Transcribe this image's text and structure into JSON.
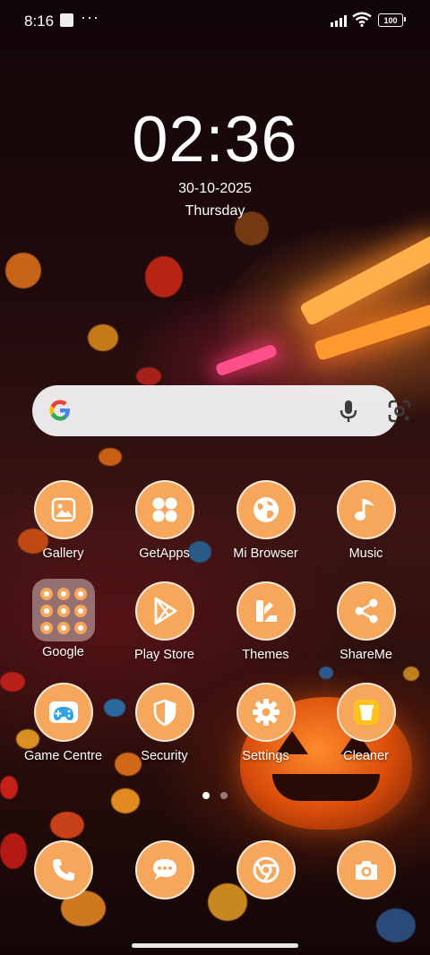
{
  "status_bar": {
    "time": "8:16",
    "more": "···",
    "battery": "100"
  },
  "clock": {
    "time": "02:36",
    "date": "30-10-2025",
    "day": "Thursday"
  },
  "search_bar": {
    "logo_icon": "google-g-icon",
    "mic_icon": "microphone-icon",
    "lens_icon": "google-lens-icon"
  },
  "apps": {
    "row1": [
      {
        "label": "Gallery",
        "icon": "gallery-icon"
      },
      {
        "label": "GetApps",
        "icon": "getapps-icon"
      },
      {
        "label": "Mi Browser",
        "icon": "globe-icon"
      },
      {
        "label": "Music",
        "icon": "music-note-icon"
      }
    ],
    "row2": [
      {
        "label": "Google",
        "icon": "folder-icon"
      },
      {
        "label": "Play Store",
        "icon": "play-store-icon"
      },
      {
        "label": "Themes",
        "icon": "themes-icon"
      },
      {
        "label": "ShareMe",
        "icon": "share-icon"
      }
    ],
    "row3": [
      {
        "label": "Game Centre",
        "icon": "gamepad-icon"
      },
      {
        "label": "Security",
        "icon": "shield-icon"
      },
      {
        "label": "Settings",
        "icon": "gear-icon"
      },
      {
        "label": "Cleaner",
        "icon": "trash-bin-icon"
      }
    ]
  },
  "pager": {
    "pages": 2,
    "current": 1
  },
  "dock": [
    {
      "icon": "phone-icon"
    },
    {
      "icon": "messages-icon"
    },
    {
      "icon": "chrome-icon"
    },
    {
      "icon": "camera-icon"
    }
  ],
  "colors": {
    "icon_fill": "#f7a75b",
    "search_bg": "#f5f5f8"
  }
}
